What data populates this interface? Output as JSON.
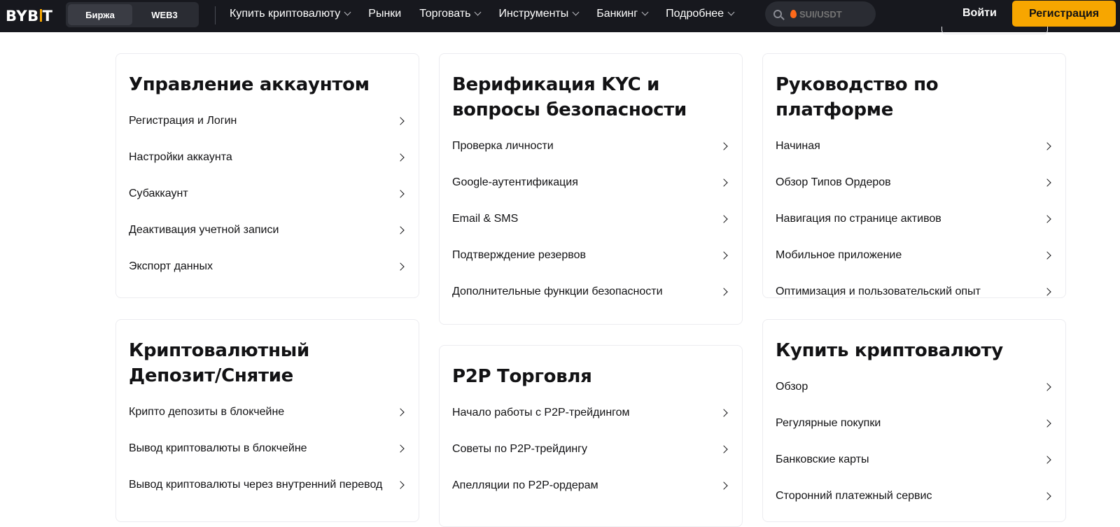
{
  "header": {
    "logo": {
      "left": "BYB",
      "right": "T"
    },
    "segments": [
      {
        "label": "Биржа",
        "active": true
      },
      {
        "label": "WEB3",
        "active": false
      }
    ],
    "nav": [
      {
        "label": "Купить криптовалюту",
        "dropdown": true
      },
      {
        "label": "Рынки",
        "dropdown": false
      },
      {
        "label": "Торговать",
        "dropdown": true
      },
      {
        "label": "Инструменты",
        "dropdown": true
      },
      {
        "label": "Банкинг",
        "dropdown": true
      },
      {
        "label": "Подробнее",
        "dropdown": true
      }
    ],
    "search": {
      "placeholder": "SUI/USDT"
    },
    "login_label": "Войти",
    "register_label": "Регистрация"
  },
  "cards": [
    {
      "title": "Управление аккаунтом",
      "items": [
        "Регистрация и Логин",
        "Настройки аккаунта",
        "Субаккаунт",
        "Деактивация учетной записи",
        "Экспорт данных"
      ]
    },
    {
      "title": "Верификация KYC и вопросы безопасности",
      "items": [
        "Проверка личности",
        "Google-аутентификация",
        "Email & SMS",
        "Подтверждение резервов",
        "Дополнительные функции безопасности"
      ]
    },
    {
      "title": "Руководство по платформе",
      "items": [
        "Начиная",
        "Обзор Типов Ордеров",
        "Навигация по странице активов",
        "Мобильное приложение",
        "Оптимизация и пользовательский опыт"
      ]
    },
    {
      "title": "Криптовалютный Депозит/Снятие",
      "items": [
        "Крипто депозиты в блокчейне",
        "Вывод криптовалюты в блокчейне",
        "Вывод криптовалюты через внутренний перевод"
      ]
    },
    {
      "title": "P2P Торговля",
      "items": [
        "Начало работы с P2P-трейдингом",
        "Советы по P2P-трейдингу",
        "Апелляции по P2P-ордерам"
      ]
    },
    {
      "title": "Купить криптовалюту",
      "items": [
        "Обзор",
        "Регулярные покупки",
        "Банковские карты",
        "Сторонний платежный сервис"
      ]
    }
  ],
  "colors": {
    "accent": "#f7a600",
    "nav_bg": "#17181e"
  }
}
